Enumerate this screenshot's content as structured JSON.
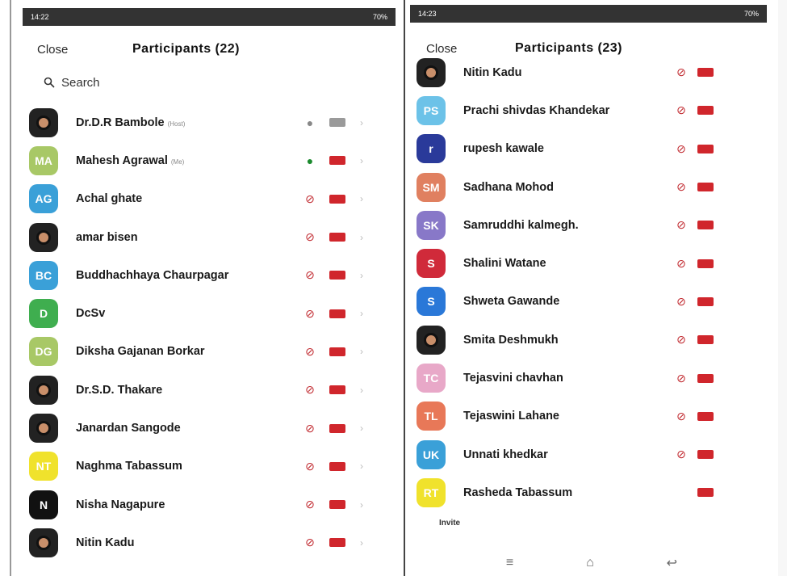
{
  "left": {
    "status": {
      "time": "14:22",
      "battery": "70%"
    },
    "close_label": "Close",
    "title": "Participants (22)",
    "search_placeholder": "Search",
    "participants": [
      {
        "name": "Dr.D.R Bambole",
        "tag": "(Host)",
        "avatar": {
          "type": "photo"
        },
        "mic": "gray",
        "cam": "gray"
      },
      {
        "name": "Mahesh Agrawal",
        "tag": "(Me)",
        "avatar": {
          "type": "initials",
          "initials": "MA",
          "color": "#a8c866"
        },
        "mic": "green",
        "cam": "red"
      },
      {
        "name": "Achal ghate",
        "tag": "",
        "avatar": {
          "type": "initials",
          "initials": "AG",
          "color": "#3aa0d8"
        },
        "mic": "muted",
        "cam": "red"
      },
      {
        "name": "amar bisen",
        "tag": "",
        "avatar": {
          "type": "photo"
        },
        "mic": "muted",
        "cam": "red"
      },
      {
        "name": "Buddhachhaya Chaurpagar",
        "tag": "",
        "avatar": {
          "type": "initials",
          "initials": "BC",
          "color": "#3aa0d8"
        },
        "mic": "muted",
        "cam": "red"
      },
      {
        "name": "DcSv",
        "tag": "",
        "avatar": {
          "type": "initials",
          "initials": "D",
          "color": "#3fae4f"
        },
        "mic": "muted",
        "cam": "red"
      },
      {
        "name": "Diksha Gajanan Borkar",
        "tag": "",
        "avatar": {
          "type": "initials",
          "initials": "DG",
          "color": "#a8c866"
        },
        "mic": "muted",
        "cam": "red"
      },
      {
        "name": "Dr.S.D. Thakare",
        "tag": "",
        "avatar": {
          "type": "photo"
        },
        "mic": "muted",
        "cam": "red"
      },
      {
        "name": "Janardan Sangode",
        "tag": "",
        "avatar": {
          "type": "photo"
        },
        "mic": "muted",
        "cam": "red"
      },
      {
        "name": "Naghma Tabassum",
        "tag": "",
        "avatar": {
          "type": "initials",
          "initials": "NT",
          "color": "#f0e22c"
        },
        "mic": "muted",
        "cam": "red"
      },
      {
        "name": "Nisha Nagapure",
        "tag": "",
        "avatar": {
          "type": "initials",
          "initials": "N",
          "color": "#111111"
        },
        "mic": "muted",
        "cam": "red"
      },
      {
        "name": "Nitin Kadu",
        "tag": "",
        "avatar": {
          "type": "photo"
        },
        "mic": "muted",
        "cam": "red"
      }
    ]
  },
  "right": {
    "status": {
      "time": "14:23",
      "battery": "70%"
    },
    "close_label": "Close",
    "title": "Participants (23)",
    "participants": [
      {
        "name": "Nitin Kadu",
        "avatar": {
          "type": "photo"
        },
        "mic": "muted",
        "cam": "red"
      },
      {
        "name": "Prachi shivdas Khandekar",
        "avatar": {
          "type": "initials",
          "initials": "PS",
          "color": "#6cc2e8"
        },
        "mic": "muted",
        "cam": "red"
      },
      {
        "name": "rupesh kawale",
        "avatar": {
          "type": "initials",
          "initials": "r",
          "color": "#2a3a9a"
        },
        "mic": "muted",
        "cam": "red"
      },
      {
        "name": "Sadhana Mohod",
        "avatar": {
          "type": "initials",
          "initials": "SM",
          "color": "#e08060"
        },
        "mic": "muted",
        "cam": "red"
      },
      {
        "name": "Samruddhi kalmegh.",
        "avatar": {
          "type": "initials",
          "initials": "SK",
          "color": "#8878c8"
        },
        "mic": "muted",
        "cam": "red"
      },
      {
        "name": "Shalini Watane",
        "avatar": {
          "type": "initials",
          "initials": "S",
          "color": "#d02a3a"
        },
        "mic": "muted",
        "cam": "red"
      },
      {
        "name": "Shweta Gawande",
        "avatar": {
          "type": "initials",
          "initials": "S",
          "color": "#2a78d8"
        },
        "mic": "muted",
        "cam": "red"
      },
      {
        "name": "Smita Deshmukh",
        "avatar": {
          "type": "photo"
        },
        "mic": "muted",
        "cam": "red"
      },
      {
        "name": "Tejasvini chavhan",
        "avatar": {
          "type": "initials",
          "initials": "TC",
          "color": "#e8a8c8"
        },
        "mic": "muted",
        "cam": "red"
      },
      {
        "name": "Tejaswini Lahane",
        "avatar": {
          "type": "initials",
          "initials": "TL",
          "color": "#e87858"
        },
        "mic": "muted",
        "cam": "red"
      },
      {
        "name": "Unnati khedkar",
        "avatar": {
          "type": "initials",
          "initials": "UK",
          "color": "#3aa0d8"
        },
        "mic": "muted",
        "cam": "red"
      },
      {
        "name": "Rasheda Tabassum",
        "avatar": {
          "type": "initials",
          "initials": "RT",
          "color": "#f0e22c"
        },
        "mic": "none",
        "cam": "red"
      }
    ],
    "footer_text": "Invite",
    "nav": {
      "menu": "≡",
      "home": "⌂",
      "back": "↩"
    }
  }
}
